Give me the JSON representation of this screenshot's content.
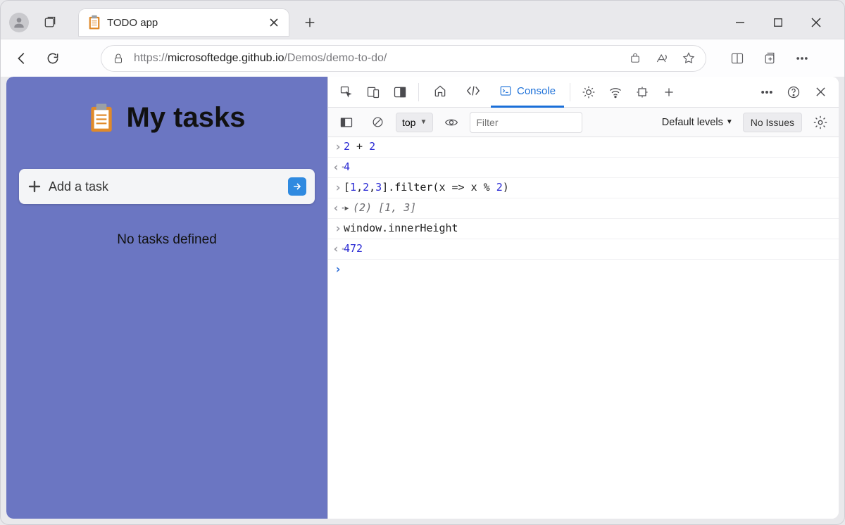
{
  "browser": {
    "tab_title": "TODO app",
    "url_scheme": "https://",
    "url_host": "microsoftedge.github.io",
    "url_path": "/Demos/demo-to-do/"
  },
  "page": {
    "heading": "My tasks",
    "add_task_placeholder": "Add a task",
    "empty_state": "No tasks defined"
  },
  "devtools": {
    "tabs": {
      "console": "Console"
    },
    "context_selector": "top",
    "filter_placeholder": "Filter",
    "levels_label": "Default levels",
    "issues_label": "No Issues",
    "console_log": [
      {
        "kind": "input",
        "tokens": [
          {
            "t": "num",
            "v": "2"
          },
          {
            "t": "txt",
            "v": " + "
          },
          {
            "t": "num",
            "v": "2"
          }
        ]
      },
      {
        "kind": "output",
        "tokens": [
          {
            "t": "num",
            "v": "4"
          }
        ]
      },
      {
        "kind": "input",
        "tokens": [
          {
            "t": "txt",
            "v": "["
          },
          {
            "t": "num",
            "v": "1"
          },
          {
            "t": "txt",
            "v": ","
          },
          {
            "t": "num",
            "v": "2"
          },
          {
            "t": "txt",
            "v": ","
          },
          {
            "t": "num",
            "v": "3"
          },
          {
            "t": "txt",
            "v": "].filter(x => x % "
          },
          {
            "t": "num",
            "v": "2"
          },
          {
            "t": "txt",
            "v": ")"
          }
        ]
      },
      {
        "kind": "output_obj",
        "summary_len": "(2)",
        "summary_body": "[1, 3]"
      },
      {
        "kind": "input",
        "tokens": [
          {
            "t": "txt",
            "v": "window.innerHeight"
          }
        ]
      },
      {
        "kind": "output",
        "tokens": [
          {
            "t": "num",
            "v": "472"
          }
        ]
      }
    ]
  }
}
